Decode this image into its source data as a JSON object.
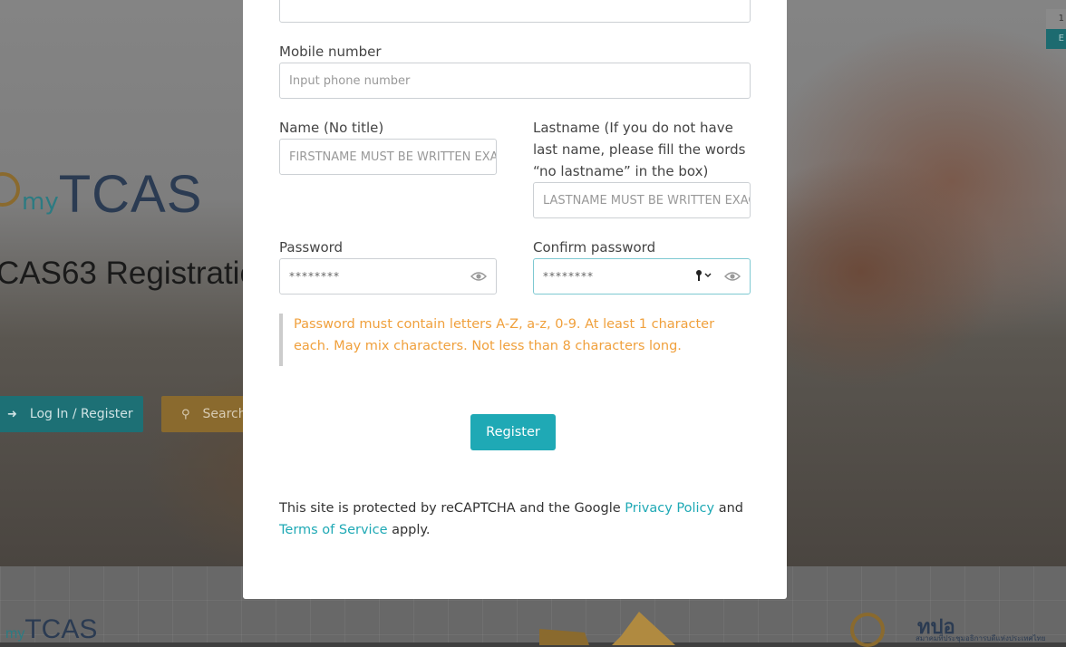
{
  "background": {
    "logo_my": "my",
    "logo_tcas": "TCAS",
    "title": "CAS63 Registratio",
    "login_button": "Log In / Register",
    "search_button": "Search",
    "corner_top": "1",
    "corner_bottom": "E",
    "footer_logo_my": "my",
    "footer_logo_tcas": "TCAS",
    "footer_right_title": "ทปอ",
    "footer_right_sub": "สมาคมที่ประชุมอธิการบดีแห่งประเทศไทย"
  },
  "form": {
    "mobile_label": "Mobile number",
    "mobile_placeholder": "Input phone number",
    "name_label": "Name (No title)",
    "name_placeholder": "FIRSTNAME MUST BE WRITTEN EXA",
    "lastname_label": "Lastname (If you do not have last name, please fill the words “no lastname” in the box)",
    "lastname_placeholder": "LASTNAME MUST BE WRITTEN EXAC",
    "password_label": "Password",
    "password_value": "********",
    "confirm_label": "Confirm password",
    "confirm_value": "********",
    "password_notice": "Password must contain letters A-Z, a-z, 0-9. At least 1 character each. May mix characters. Not less than 8 characters long.",
    "register_label": "Register"
  },
  "recaptcha": {
    "prefix": "This site is protected by reCAPTCHA and the Google ",
    "privacy_link": "Privacy Policy",
    "and_text": " and",
    "terms_link": "Terms of Service",
    "suffix": " apply."
  },
  "colors": {
    "accent": "#1fa9b5",
    "notice": "#f0a03c",
    "login_bg": "#1d7075",
    "search_bg": "#8a6a2e"
  }
}
